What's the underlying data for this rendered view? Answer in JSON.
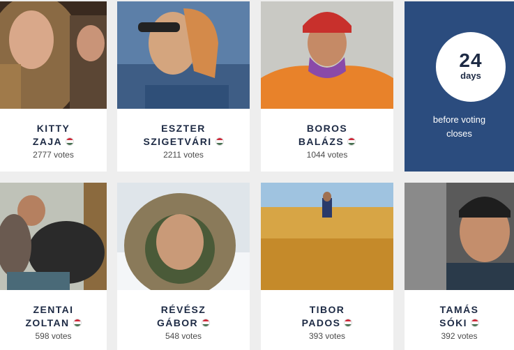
{
  "flag_colors": [
    "#ce2939",
    "#ffffff",
    "#477050"
  ],
  "contestants": [
    {
      "first": "KITTY",
      "last": "ZAJA",
      "votes": "2777 votes"
    },
    {
      "first": "ESZTER",
      "last": "SZIGETVÁRI",
      "votes": "2211 votes"
    },
    {
      "first": "BOROS",
      "last": "BALÁZS",
      "votes": "1044 votes"
    },
    {
      "first": "ZENTAI",
      "last": "ZOLTAN",
      "votes": "598 votes"
    },
    {
      "first": "RÉVÉSZ",
      "last": "GÁBOR",
      "votes": "548 votes"
    },
    {
      "first": "TIBOR",
      "last": "PADOS",
      "votes": "393 votes"
    },
    {
      "first": "TAMÁS",
      "last": "SÓKI",
      "votes": "392 votes"
    }
  ],
  "countdown": {
    "number": "24",
    "unit": "days",
    "line1": "before voting",
    "line2": "closes",
    "color": "#2b4c7e"
  }
}
